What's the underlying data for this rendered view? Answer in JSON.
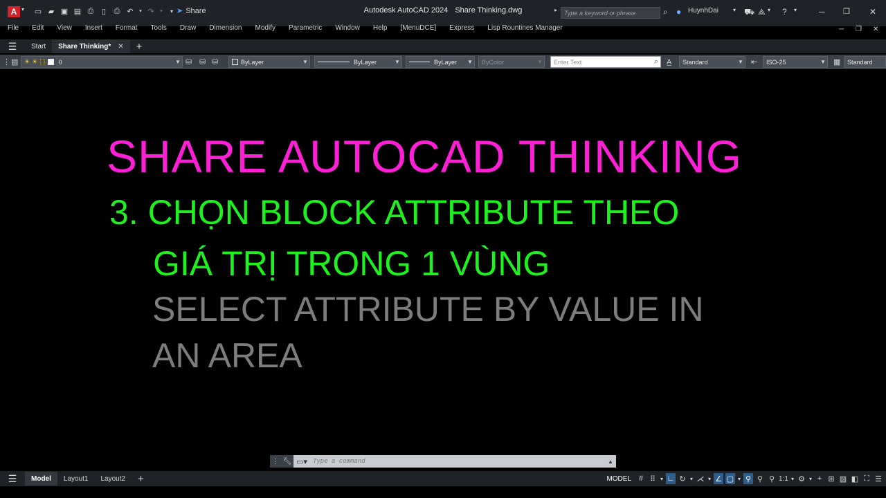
{
  "window": {
    "app_title": "Autodesk AutoCAD 2024",
    "file_title": "Share Thinking.dwg",
    "logo_letter": "A",
    "share_label": "Share",
    "search_placeholder": "Type a keyword or phrase",
    "user_name": "HuynhDai"
  },
  "menu": {
    "items": [
      "File",
      "Edit",
      "View",
      "Insert",
      "Format",
      "Tools",
      "Draw",
      "Dimension",
      "Modify",
      "Parametric",
      "Window",
      "Help",
      "[MenuDCE]",
      "Express",
      "Lisp Rountines Manager"
    ]
  },
  "tabs": {
    "start_label": "Start",
    "active_label": "Share Thinking*"
  },
  "properties": {
    "layer_value": "0",
    "color_value": "ByLayer",
    "linetype_value": "ByLayer",
    "lineweight_value": "ByLayer",
    "plotstyle_value": "ByColor",
    "text_placeholder": "Enter Text",
    "text_style": "Standard",
    "dim_style": "ISO-25",
    "table_style": "Standard"
  },
  "canvas": {
    "line1": "SHARE AUTOCAD THINKING",
    "line2": "3. CHỌN BLOCK ATTRIBUTE THEO",
    "line3": "GIÁ TRỊ TRONG 1 VÙNG",
    "line4": "SELECT ATTRIBUTE BY VALUE IN",
    "line5": "AN AREA",
    "colors": {
      "line1": "#ff1fd6",
      "lines2_3": "#1ef21e",
      "lines4_5": "#7d7d7d"
    }
  },
  "command": {
    "placeholder": "Type a command"
  },
  "statusbar": {
    "layout_tabs": [
      "Model",
      "Layout1",
      "Layout2"
    ],
    "model_label": "MODEL",
    "scale_label": "1:1"
  }
}
